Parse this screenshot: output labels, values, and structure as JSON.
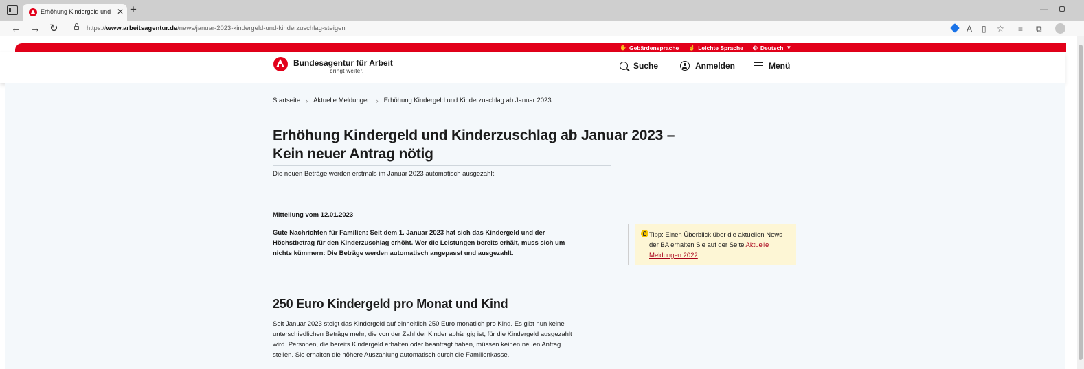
{
  "browser": {
    "tab_title": "Erhöhung Kindergeld und Kinde",
    "url_prefix": "https://",
    "url_domain": "www.arbeitsagentur.de",
    "url_path": "/news/januar-2023-kindergeld-und-kinderzuschlag-steigen"
  },
  "topbar": {
    "sign_language": "Gebärdensprache",
    "easy_language": "Leichte Sprache",
    "language": "Deutsch"
  },
  "header": {
    "brand_name": "Bundesagentur für Arbeit",
    "brand_claim": "bringt weiter.",
    "search_label": "Suche",
    "login_label": "Anmelden",
    "menu_label": "Menü"
  },
  "breadcrumb": {
    "home": "Startseite",
    "news": "Aktuelle Meldungen",
    "current": "Erhöhung Kindergeld und Kinderzuschlag ab Januar 2023"
  },
  "article": {
    "title": "Erhöhung Kindergeld und Kinderzuschlag ab Januar 2023 – Kein neuer Antrag nötig",
    "lead": "Die neuen Beträge werden erstmals im Januar 2023 automatisch ausgezahlt.",
    "date_line": "Mitteilung vom 12.01.2023",
    "intro": "Gute Nachrichten für Familien: Seit dem 1. Januar 2023 hat sich das Kindergeld und der Höchstbetrag für den Kinderzuschlag erhöht. Wer die Leistungen bereits erhält, muss sich um nichts kümmern: Die Beträge werden automatisch angepasst und ausgezahlt.",
    "section_title": "250 Euro Kindergeld pro Monat und Kind",
    "section_text": "Seit Januar 2023 steigt das Kindergeld auf einheitlich 250 Euro monatlich pro Kind. Es gibt nun keine unterschiedlichen Beträge mehr, die von der Zahl der Kinder abhängig ist, für die Kindergeld ausgezahlt wird. Personen, die bereits Kindergeld erhalten oder beantragt haben, müssen keinen neuen Antrag stellen. Sie erhalten die höhere Auszahlung automatisch durch die Familienkasse."
  },
  "tip": {
    "text": "Tipp: Einen Überblick über die aktuellen News der BA erhalten Sie auf der Seite",
    "link": "Aktuelle Meldungen 2022"
  },
  "colors": {
    "brand_red": "#e2001a",
    "page_bg": "#f4f8fb",
    "tip_bg": "#fdf6d5",
    "link_red": "#a8001a"
  }
}
